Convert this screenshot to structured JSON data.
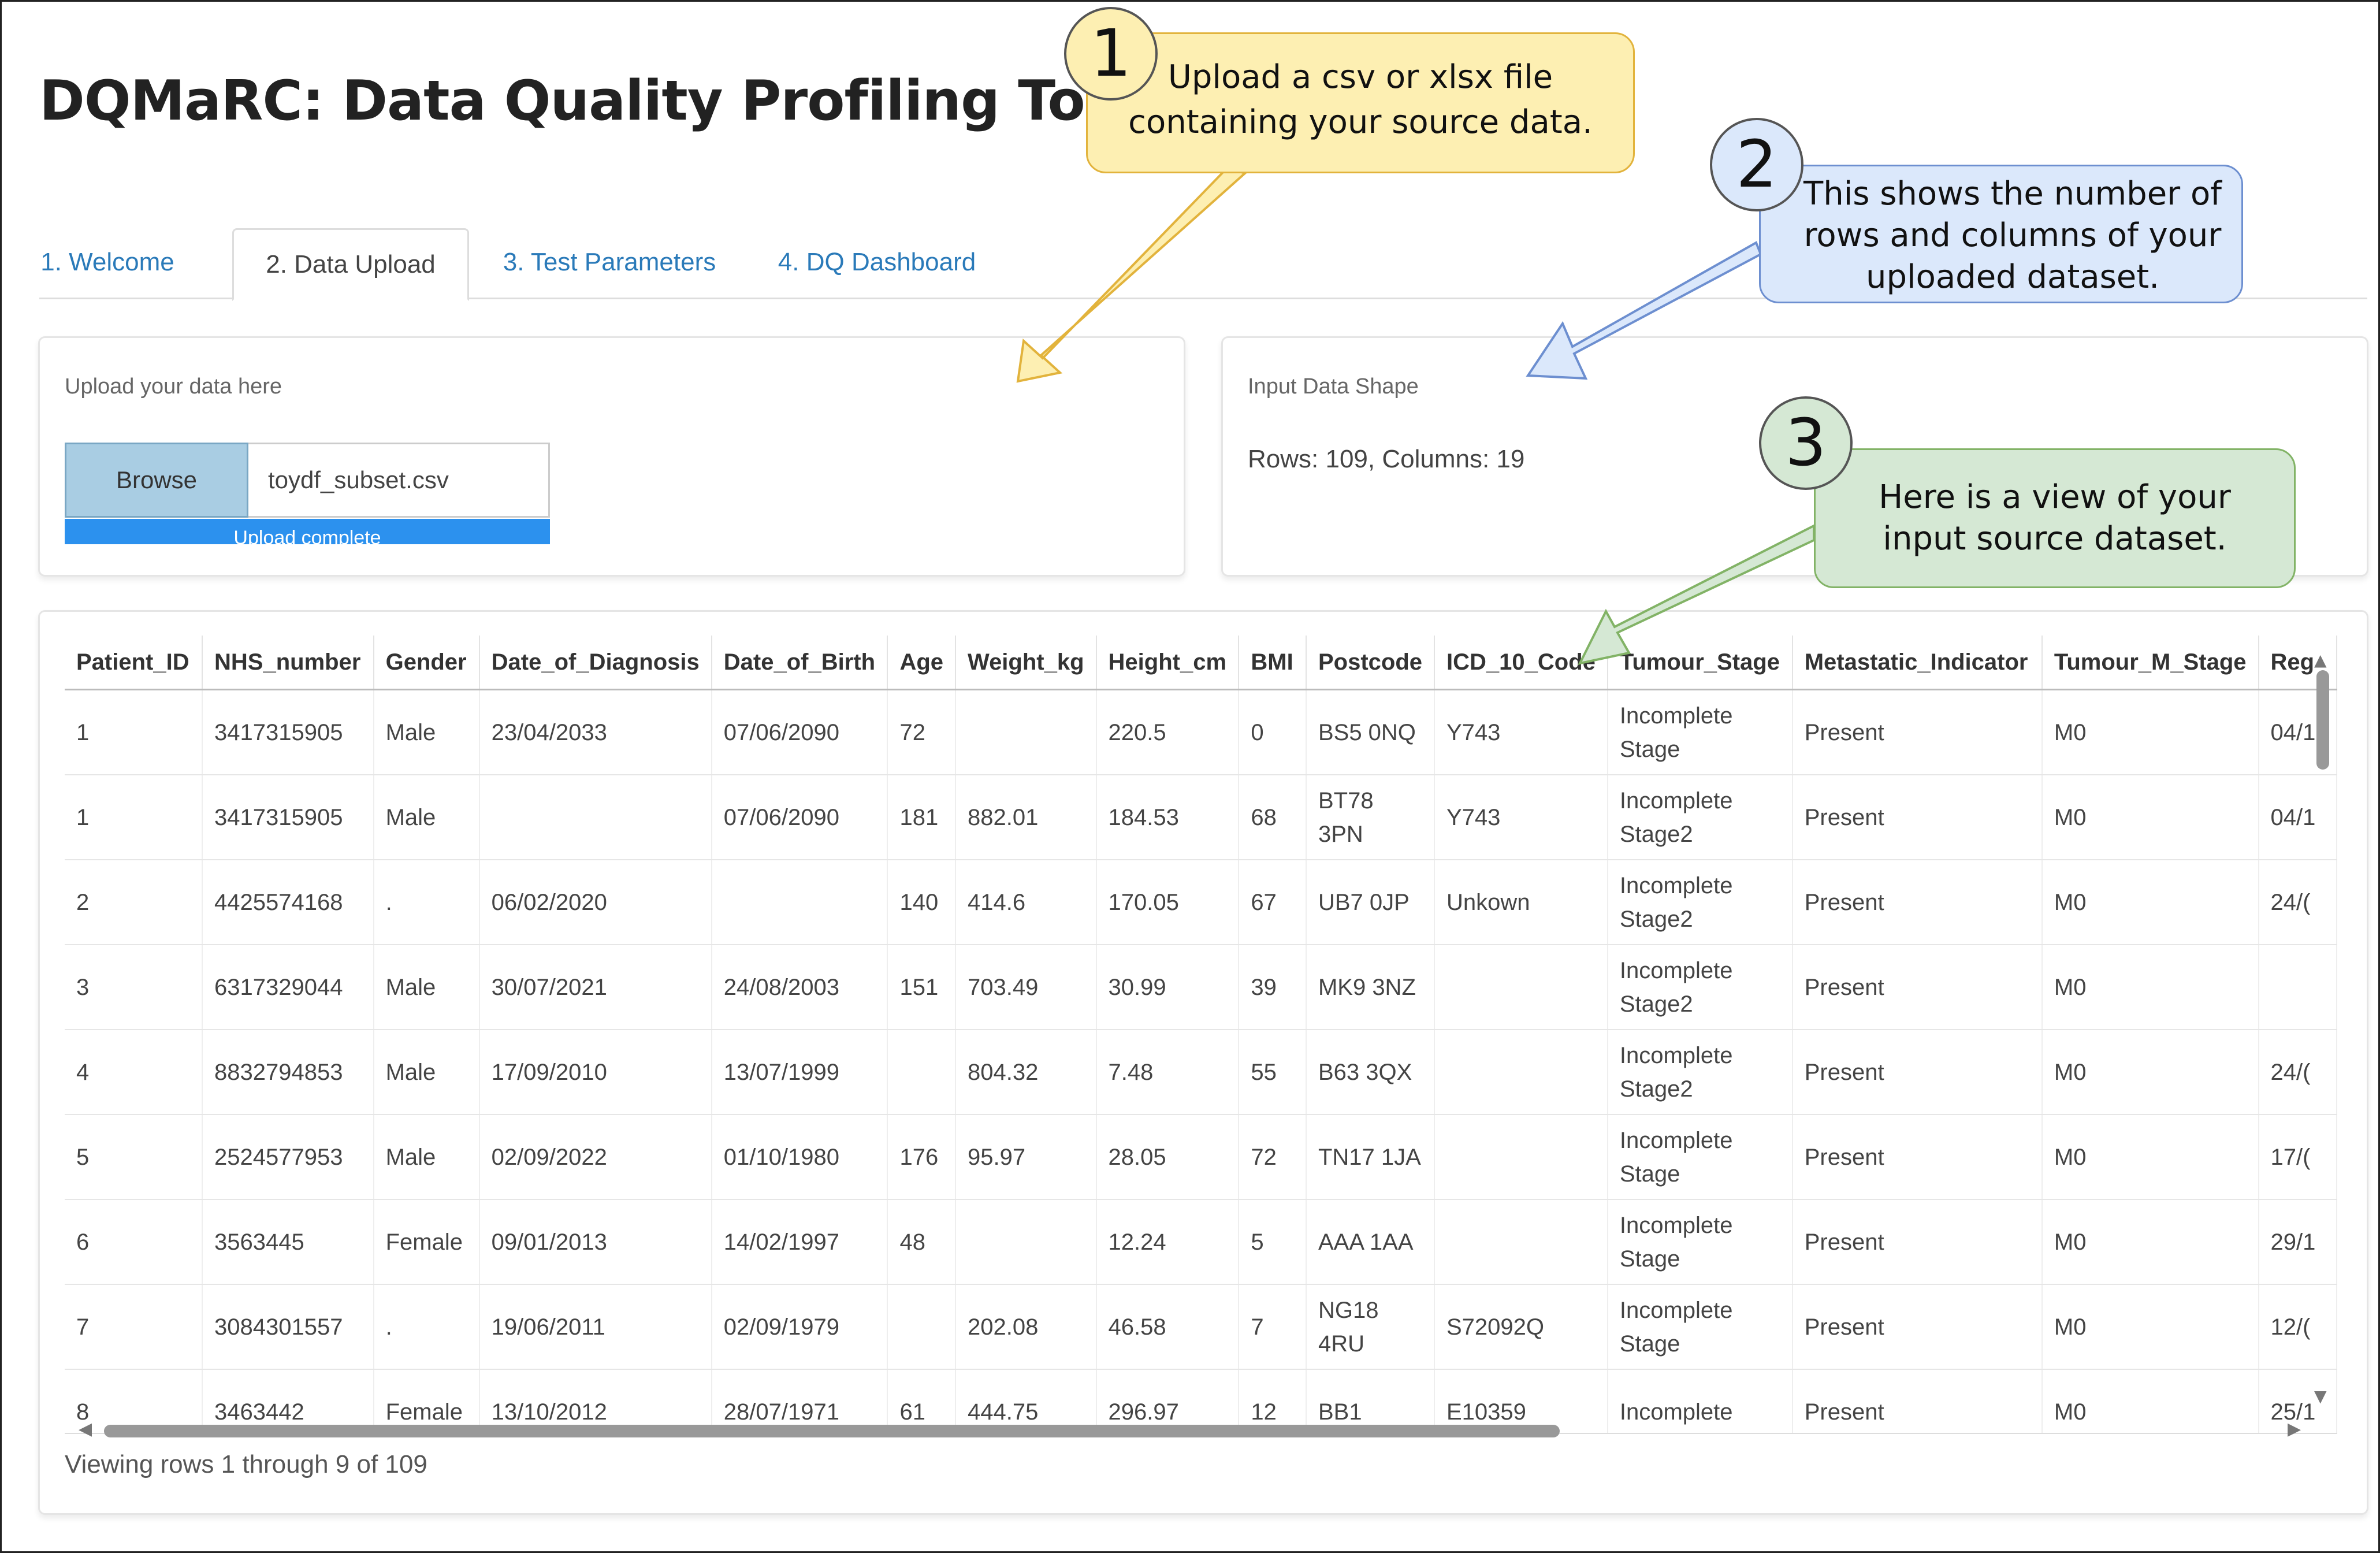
{
  "app": {
    "title": "DQMaRC: Data Quality Profiling Tool"
  },
  "tabs": [
    "1. Welcome",
    "2. Data Upload",
    "3. Test Parameters",
    "4. DQ Dashboard"
  ],
  "upload": {
    "label": "Upload your data here",
    "browse_label": "Browse",
    "file_name": "toydf_subset.csv",
    "progress_text": "Upload complete",
    "progress": 1.0
  },
  "shape": {
    "label": "Input Data Shape",
    "text": "Rows: 109, Columns: 19"
  },
  "table": {
    "columns": [
      "Patient_ID",
      "NHS_number",
      "Gender",
      "Date_of_Diagnosis",
      "Date_of_Birth",
      "Age",
      "Weight_kg",
      "Height_cm",
      "BMI",
      "Postcode",
      "ICD_10_Code",
      "Tumour_Stage",
      "Metastatic_Indicator",
      "Tumour_M_Stage",
      "Reg"
    ],
    "rows": [
      [
        "1",
        "3417315905",
        "Male",
        "23/04/2033",
        "07/06/2090",
        "72",
        "",
        "220.5",
        "0",
        "BS5 0NQ",
        "Y743",
        "Incomplete Stage",
        "Present",
        "M0",
        "04/1"
      ],
      [
        "1",
        "3417315905",
        "Male",
        "",
        "07/06/2090",
        "181",
        "882.01",
        "184.53",
        "68",
        "BT78 3PN",
        "Y743",
        "Incomplete Stage2",
        "Present",
        "M0",
        "04/1"
      ],
      [
        "2",
        "4425574168",
        ".",
        "06/02/2020",
        "",
        "140",
        "414.6",
        "170.05",
        "67",
        "UB7 0JP",
        "Unkown",
        "Incomplete Stage2",
        "Present",
        "M0",
        "24/("
      ],
      [
        "3",
        "6317329044",
        "Male",
        "30/07/2021",
        "24/08/2003",
        "151",
        "703.49",
        "30.99",
        "39",
        "MK9 3NZ",
        "",
        "Incomplete Stage2",
        "Present",
        "M0",
        ""
      ],
      [
        "4",
        "8832794853",
        "Male",
        "17/09/2010",
        "13/07/1999",
        "",
        "804.32",
        "7.48",
        "55",
        "B63 3QX",
        "",
        "Incomplete Stage2",
        "Present",
        "M0",
        "24/("
      ],
      [
        "5",
        "2524577953",
        "Male",
        "02/09/2022",
        "01/10/1980",
        "176",
        "95.97",
        "28.05",
        "72",
        "TN17 1JA",
        "",
        "Incomplete Stage",
        "Present",
        "M0",
        "17/("
      ],
      [
        "6",
        "3563445",
        "Female",
        "09/01/2013",
        "14/02/1997",
        "48",
        "",
        "12.24",
        "5",
        "AAA 1AA",
        "",
        "Incomplete Stage",
        "Present",
        "M0",
        "29/1"
      ],
      [
        "7",
        "3084301557",
        ".",
        "19/06/2011",
        "02/09/1979",
        "",
        "202.08",
        "46.58",
        "7",
        "NG18 4RU",
        "S72092Q",
        "Incomplete Stage",
        "Present",
        "M0",
        "12/("
      ],
      [
        "8",
        "3463442",
        "Female",
        "13/10/2012",
        "28/07/1971",
        "61",
        "444.75",
        "296.97",
        "12",
        "BB1",
        "E10359",
        "Incomplete",
        "Present",
        "M0",
        "25/1"
      ]
    ],
    "footer": "Viewing rows 1 through 9 of 109"
  },
  "callouts": [
    {
      "number": "1",
      "text": "Upload a csv or xlsx file containing your source data.",
      "color": "#fdefb2",
      "border": "#e2b33c"
    },
    {
      "number": "2",
      "text": "This shows the number of rows and columns of your uploaded dataset.",
      "color": "#dbe8fb",
      "border": "#6d8fd0"
    },
    {
      "number": "3",
      "text": "Here is a view of your input source dataset.",
      "color": "#d5e8d4",
      "border": "#82b366"
    }
  ]
}
